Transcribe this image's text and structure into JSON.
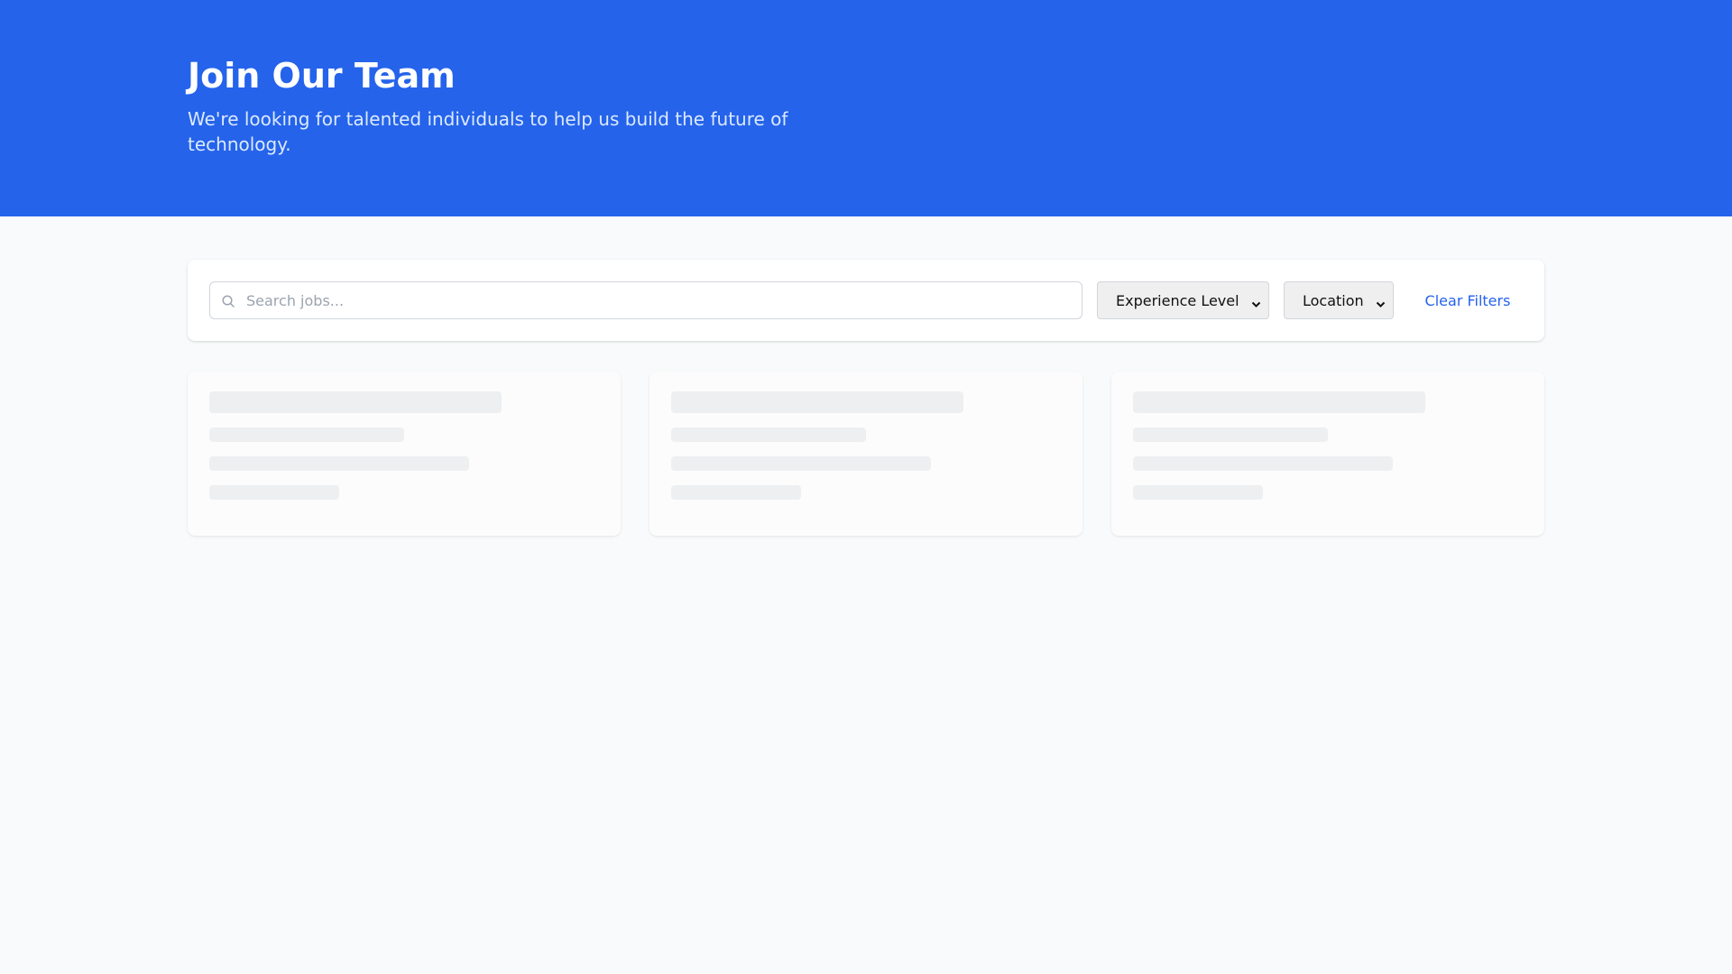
{
  "hero": {
    "title": "Join Our Team",
    "subtitle": "We're looking for talented individuals to help us build the future of technology."
  },
  "filters": {
    "search_placeholder": "Search jobs...",
    "search_value": "",
    "search_icon": "search-icon",
    "experience_label": "Experience Level",
    "location_label": "Location",
    "clear_label": "Clear Filters"
  },
  "colors": {
    "brand": "#2563eb",
    "page_background": "#f9fafb",
    "skeleton": "#eeeff1"
  },
  "job_cards": {
    "state": "loading",
    "count": 3
  }
}
